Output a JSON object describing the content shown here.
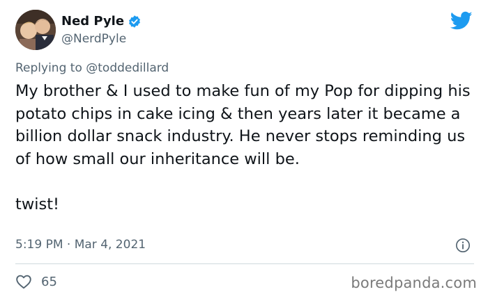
{
  "author": {
    "display_name": "Ned Pyle",
    "handle": "@NerdPyle",
    "verified": true
  },
  "reply_context": {
    "prefix": "Replying to",
    "mention": "@toddedillard"
  },
  "tweet": {
    "paragraph_1": "My brother & I used to make fun of my Pop for dipping his potato chips in cake icing & then years later it became a billion dollar snack industry. He never stops reminding us of how small our inheritance will be.",
    "paragraph_2": "twist!",
    "timestamp": "5:19 PM · Mar 4, 2021",
    "like_count": "65"
  },
  "watermark": "boredpanda.com",
  "icons": {
    "platform": "twitter-bird-icon",
    "verified": "verified-badge-icon",
    "info": "info-icon",
    "like": "heart-icon"
  },
  "colors": {
    "brand_blue": "#1d9bf0",
    "text_primary": "#0f1419",
    "text_secondary": "#536471",
    "divider": "#cfd9de"
  }
}
